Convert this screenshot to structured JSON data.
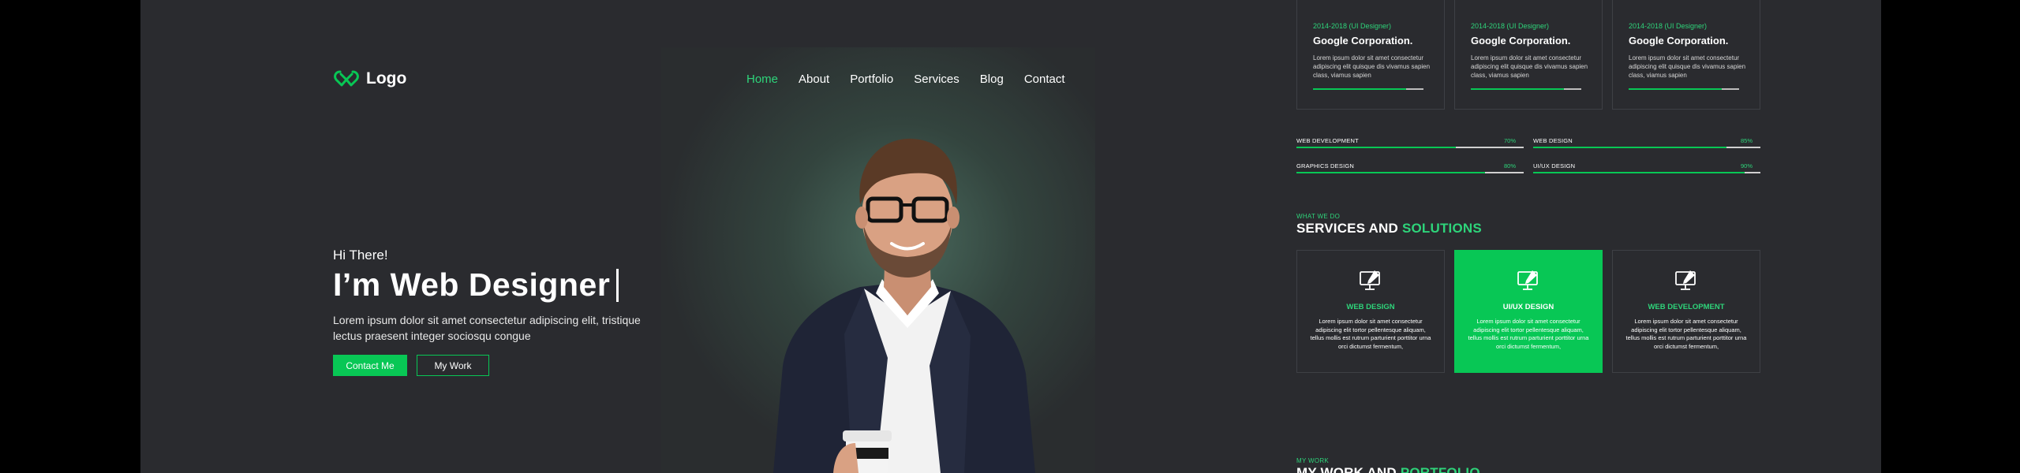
{
  "brand": {
    "name": "Logo",
    "accent": "#08c755",
    "accent_text": "#2ed47a",
    "background": "#2a2b2f"
  },
  "nav": {
    "items": [
      "Home",
      "About",
      "Portfolio",
      "Services",
      "Blog",
      "Contact"
    ],
    "active": "Home"
  },
  "hero": {
    "greeting": "Hi There!",
    "headline": "I’m Web Designer",
    "description": "Lorem ipsum dolor sit amet consectetur adipiscing elit, tristique lectus praesent integer sociosqu congue",
    "primary_button": "Contact Me",
    "secondary_button": "My Work"
  },
  "experience": [
    {
      "date": "2014-2018 (UI Designer)",
      "company": "Google Corporation.",
      "text": "Lorem ipsum dolor sit amet consectetur adipiscing elit quisque dis vivamus sapien class, viamus sapien"
    },
    {
      "date": "2014-2018 (UI Designer)",
      "company": "Google Corporation.",
      "text": "Lorem ipsum dolor sit amet consectetur adipiscing elit quisque dis vivamus sapien class, viamus sapien"
    },
    {
      "date": "2014-2018 (UI Designer)",
      "company": "Google Corporation.",
      "text": "Lorem ipsum dolor sit amet consectetur adipiscing elit quisque dis vivamus sapien class, viamus sapien"
    }
  ],
  "skills": [
    {
      "name": "WEB DEVELOPMENT",
      "percent_label": "70%",
      "level": 0.7
    },
    {
      "name": "WEB DESIGN",
      "percent_label": "85%",
      "level": 0.85
    },
    {
      "name": "GRAPHICS DESIGN",
      "percent_label": "80%",
      "level": 0.83
    },
    {
      "name": "UI/UX DESIGN",
      "percent_label": "90%",
      "level": 0.93
    }
  ],
  "services_section": {
    "kicker": "WHAT WE DO",
    "title_main": "SERVICES AND",
    "title_accent": "SOLUTIONS"
  },
  "services": [
    {
      "title": "WEB DESIGN",
      "text": "Lorem ipsum dolor sit amet consectetur adipiscing elit tortor pellentesque aliquam, tellus mollis est rutrum parturient porttitor urna orci dictumst fermentum,",
      "icon": "monitor-pen-icon",
      "active": false
    },
    {
      "title": "UI/UX DESIGN",
      "text": "Lorem ipsum dolor sit amet consectetur adipiscing elit tortor pellentesque aliquam, tellus mollis est rutrum parturient porttitor urna orci dictumst fermentum,",
      "icon": "monitor-pen-icon",
      "active": true
    },
    {
      "title": "WEB DEVELOPMENT",
      "text": "Lorem ipsum dolor sit amet consectetur adipiscing elit tortor pellentesque aliquam, tellus mollis est rutrum parturient porttitor urna orci dictumst fermentum,",
      "icon": "monitor-pen-icon",
      "active": false
    }
  ],
  "work_section": {
    "kicker": "MY WORK",
    "title_main": "MY WORK AND",
    "title_accent": "PORTFOLIO"
  }
}
